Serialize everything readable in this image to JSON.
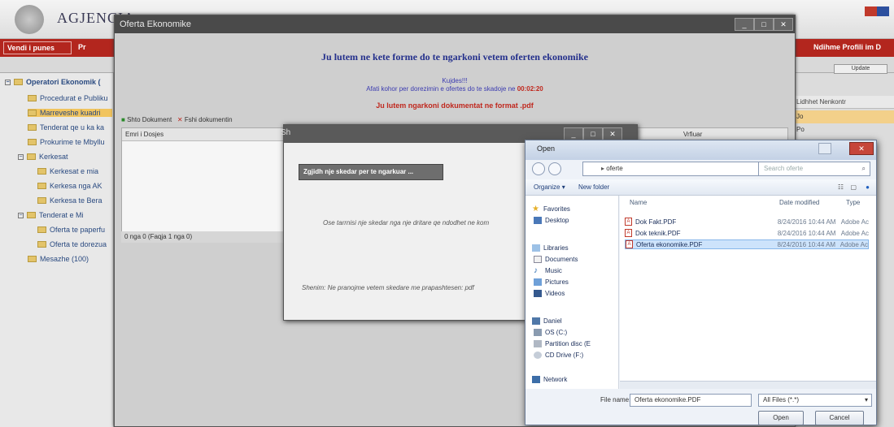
{
  "app": {
    "agency": "AGJENCIA",
    "nav_active": "Vendi i punes",
    "nav_short": "Pr",
    "nav_right": "Ndihme  Profili im  D",
    "sidebar": {
      "root": "Operatori Ekonomik (",
      "items": [
        "Procedurat e Publiku",
        "Marreveshe kuadri",
        "Tenderat qe u ka ka",
        "Prokurime te Mbyllu",
        "Kerkesat",
        "Kerkesat e mia",
        "Kerkesa nga AK",
        "Kerkesa te Bera",
        "Tenderat e Mi",
        "Oferta te paperfu",
        "Oferta te dorezua",
        "Mesazhe (100)"
      ]
    },
    "right_panel": {
      "button": "Update",
      "header": "Lidhhet Nenkontr",
      "rows": [
        "Jo",
        "Po"
      ]
    }
  },
  "ekonomike_window": {
    "title": "Oferta Ekonomike",
    "headline": "Ju lutem ne kete forme do te ngarkoni vetem oferten ekonomike",
    "info_line1": "Kujdes!!!",
    "info_line2": "Afati kohor per dorezimin e ofertes do te skadoje ne",
    "countdown": "00:02:20",
    "warning": "Ju lutem ngarkoni dokumentat ne format .pdf",
    "toolbar_add": "Shto Dokument",
    "toolbar_delete": "Fshi dokumentin",
    "column1": "Emri i Dosjes",
    "column2": "Vrfiuar",
    "footer": "0 nga 0 (Faqja 1 nga 0)"
  },
  "upload_dialog": {
    "title": "Sh",
    "upload_button": "Zgjidh nje skedar per te ngarkuar ...",
    "empty_msg": "Ose tarrnisi nje skedar nga nje dritare qe ndodhet ne kom",
    "note": "Shenim: Ne pranojme vetem skedare me prapashtesen: pdf"
  },
  "open_dialog": {
    "title": "Open",
    "path_folder": "oferte",
    "search_placeholder": "Search oferte",
    "organize": "Organize",
    "new_folder": "New folder",
    "nav": {
      "favorites": "Favorites",
      "desktop": "Desktop",
      "libraries": "Libraries",
      "documents": "Documents",
      "music": "Music",
      "pictures": "Pictures",
      "videos": "Videos",
      "computer": "Daniel",
      "os": "OS (C:)",
      "partition": "Partition disc (E",
      "cddrive": "CD Drive (F:)",
      "network": "Network"
    },
    "columns": {
      "name": "Name",
      "date": "Date modified",
      "type": "Type"
    },
    "files": [
      {
        "name": "Dok Fakt.PDF",
        "date": "8/24/2016 10:44 AM",
        "type": "Adobe Ac"
      },
      {
        "name": "Dok teknik.PDF",
        "date": "8/24/2016 10:44 AM",
        "type": "Adobe Ac"
      },
      {
        "name": "Oferta ekonomike.PDF",
        "date": "8/24/2016 10:44 AM",
        "type": "Adobe Ac"
      }
    ],
    "file_name_label": "File name:",
    "file_name_value": "Oferta ekonomike.PDF",
    "file_type": "All Files (*.*)",
    "open_button": "Open",
    "cancel_button": "Cancel"
  }
}
